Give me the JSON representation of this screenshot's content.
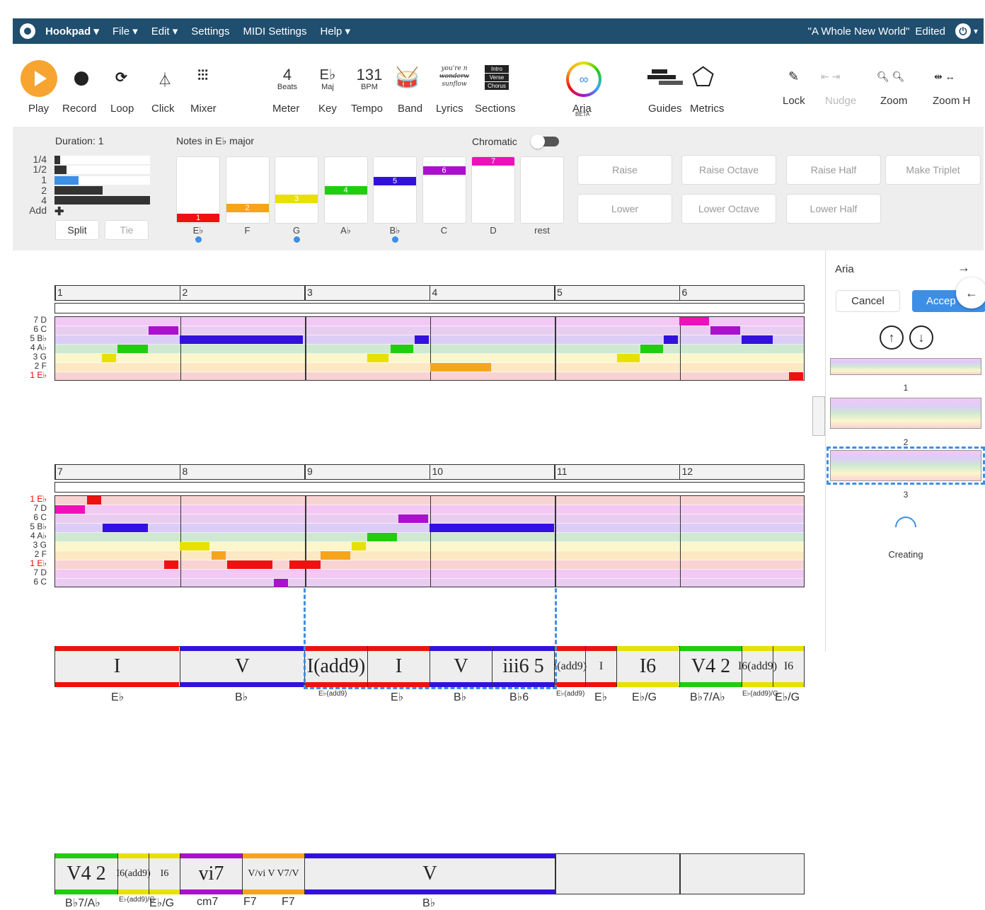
{
  "menubar": {
    "brand": "Hookpad ▾",
    "file": "File ▾",
    "edit": "Edit ▾",
    "settings": "Settings",
    "midi_settings": "MIDI Settings",
    "help": "Help ▾",
    "song_title": "\"A Whole New World\"",
    "edited": "Edited",
    "power_caret": "▾"
  },
  "toolbar": {
    "play": "Play",
    "record": "Record",
    "loop": "Loop",
    "click": "Click",
    "mixer": "Mixer",
    "meter_value": "4",
    "meter_sub": "Beats",
    "meter": "Meter",
    "key_value": "E♭",
    "key_sub": "Maj",
    "key": "Key",
    "tempo_value": "131",
    "tempo_sub": "BPM",
    "tempo": "Tempo",
    "band": "Band",
    "lyrics_snippet_1": "you're n",
    "lyrics_snippet_2": "wonderw",
    "lyrics_snippet_3": "sunflow",
    "lyrics": "Lyrics",
    "sections_intro": "Intro",
    "sections_verse": "Verse",
    "sections_chorus": "Chorus",
    "sections": "Sections",
    "aria": "Aria",
    "aria_beta": "BETA",
    "guides": "Guides",
    "metrics": "Metrics",
    "lock": "Lock",
    "nudge": "Nudge",
    "zoom": "Zoom",
    "zoom_h": "Zoom H"
  },
  "editpanel": {
    "duration_label": "Duration: 1",
    "durations": [
      "1/4",
      "1/2",
      "1",
      "2",
      "4"
    ],
    "add_label": "Add",
    "split": "Split",
    "tie": "Tie",
    "notes_title": "Notes in E♭ major",
    "chromatic_label": "Chromatic",
    "notes": [
      {
        "deg": "1",
        "name": "E♭",
        "color": "#ee1111",
        "dot": true
      },
      {
        "deg": "2",
        "name": "F",
        "color": "#f7a41d",
        "dot": false
      },
      {
        "deg": "3",
        "name": "G",
        "color": "#e8e000",
        "dot": true
      },
      {
        "deg": "4",
        "name": "A♭",
        "color": "#22cc11",
        "dot": false
      },
      {
        "deg": "5",
        "name": "B♭",
        "color": "#3311dd",
        "dot": true
      },
      {
        "deg": "6",
        "name": "C",
        "color": "#aa11cc",
        "dot": false
      },
      {
        "deg": "7",
        "name": "D",
        "color": "#ee11bb",
        "dot": false
      }
    ],
    "rest_label": "rest",
    "actions": {
      "raise": "Raise",
      "raise_octave": "Raise Octave",
      "raise_half": "Raise Half",
      "make_triplet": "Make Triplet",
      "lower": "Lower",
      "lower_octave": "Lower Octave",
      "lower_half": "Lower Half"
    }
  },
  "score": {
    "row1": {
      "measures": [
        "1",
        "2",
        "3",
        "4",
        "5",
        "6"
      ],
      "roll_labels": [
        "7 D",
        "6 C",
        "5 B♭",
        "4 A♭",
        "3 G",
        "2 F",
        "1 E♭"
      ],
      "chords": [
        "I",
        "V",
        "I(add9)",
        "I",
        "V",
        "iii6 5",
        "I(add9)",
        "I",
        "I6",
        "V4 2",
        "I6(add9)",
        "I6"
      ],
      "chord_names": [
        "E♭",
        "B♭",
        "E♭(add9)",
        "E♭",
        "B♭",
        "B♭6",
        "E♭(add9)",
        "E♭",
        "E♭/G",
        "B♭7/A♭",
        "E♭(add9)/G",
        "E♭/G"
      ]
    },
    "row2": {
      "measures": [
        "7",
        "8",
        "9",
        "10",
        "11",
        "12"
      ],
      "roll_labels": [
        "1 E♭",
        "7 D",
        "6 C",
        "5 B♭",
        "4 A♭",
        "3 G",
        "2 F",
        "1 E♭",
        "7 D",
        "6 C"
      ],
      "chords": [
        "V4 2",
        "I6(add9)",
        "I6",
        "vi7",
        "V/vi V V7/V",
        "V"
      ],
      "chord_names": [
        "B♭7/A♭",
        "E♭(add9)/G",
        "E♭/G",
        "cm7",
        "F7",
        "F7",
        "B♭"
      ]
    }
  },
  "sidepanel": {
    "title": "Aria",
    "cancel": "Cancel",
    "accept": "Accep",
    "suggestions": [
      "1",
      "2",
      "3"
    ],
    "creating": "Creating"
  }
}
